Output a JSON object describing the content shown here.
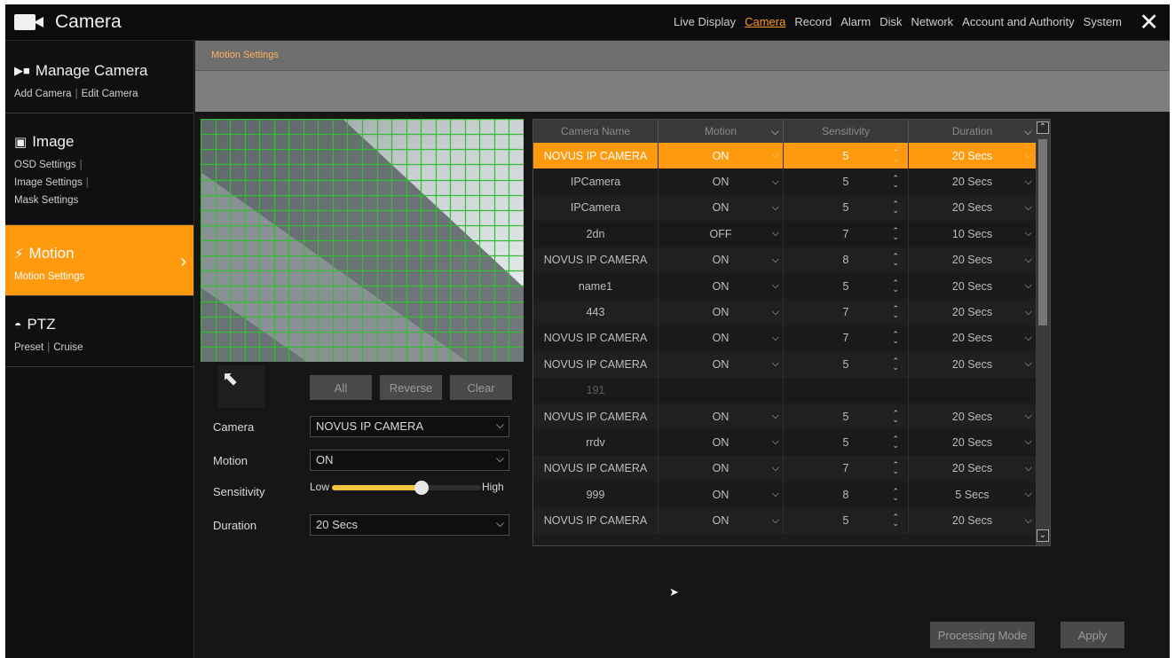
{
  "app": {
    "title": "Camera"
  },
  "topnav": [
    "Live Display",
    "Camera",
    "Record",
    "Alarm",
    "Disk",
    "Network",
    "Account and Authority",
    "System"
  ],
  "topnav_active": "Camera",
  "sidebar": {
    "manage": {
      "title": "Manage Camera",
      "links": [
        "Add Camera",
        "Edit Camera"
      ]
    },
    "image": {
      "title": "Image",
      "links": [
        "OSD Settings",
        "Image Settings",
        "Mask Settings"
      ]
    },
    "motion": {
      "title": "Motion",
      "links": [
        "Motion Settings"
      ]
    },
    "ptz": {
      "title": "PTZ",
      "links": [
        "Preset",
        "Cruise"
      ]
    }
  },
  "tab": {
    "label": "Motion Settings"
  },
  "grid_buttons": {
    "all": "All",
    "reverse": "Reverse",
    "clear": "Clear"
  },
  "form": {
    "camera_label": "Camera",
    "camera_value": "NOVUS IP CAMERA",
    "motion_label": "Motion",
    "motion_value": "ON",
    "sensitivity_label": "Sensitivity",
    "sensitivity_low": "Low",
    "sensitivity_high": "High",
    "sensitivity_level": 0.6,
    "duration_label": "Duration",
    "duration_value": "20 Secs"
  },
  "table": {
    "headers": [
      "Camera Name",
      "Motion",
      "Sensitivity",
      "Duration"
    ],
    "rows": [
      {
        "name": "NOVUS IP CAMERA",
        "motion": "ON",
        "sensitivity": "5",
        "duration": "20 Secs",
        "selected": true
      },
      {
        "name": "IPCamera",
        "motion": "ON",
        "sensitivity": "5",
        "duration": "20 Secs"
      },
      {
        "name": "IPCamera",
        "motion": "ON",
        "sensitivity": "5",
        "duration": "20 Secs"
      },
      {
        "name": "2dn",
        "motion": "OFF",
        "sensitivity": "7",
        "duration": "10 Secs"
      },
      {
        "name": "NOVUS IP CAMERA",
        "motion": "ON",
        "sensitivity": "8",
        "duration": "20 Secs"
      },
      {
        "name": "name1",
        "motion": "ON",
        "sensitivity": "5",
        "duration": "20 Secs"
      },
      {
        "name": "443",
        "motion": "ON",
        "sensitivity": "7",
        "duration": "20 Secs"
      },
      {
        "name": "NOVUS IP CAMERA",
        "motion": "ON",
        "sensitivity": "7",
        "duration": "20 Secs"
      },
      {
        "name": "NOVUS IP CAMERA",
        "motion": "ON",
        "sensitivity": "5",
        "duration": "20 Secs"
      },
      {
        "name": "191",
        "motion": "",
        "sensitivity": "",
        "duration": "",
        "dim": true
      },
      {
        "name": "NOVUS IP CAMERA",
        "motion": "ON",
        "sensitivity": "5",
        "duration": "20 Secs"
      },
      {
        "name": "rrdv",
        "motion": "ON",
        "sensitivity": "5",
        "duration": "20 Secs"
      },
      {
        "name": "NOVUS IP CAMERA",
        "motion": "ON",
        "sensitivity": "7",
        "duration": "20 Secs"
      },
      {
        "name": "999",
        "motion": "ON",
        "sensitivity": "8",
        "duration": "5 Secs"
      },
      {
        "name": "NOVUS IP CAMERA",
        "motion": "ON",
        "sensitivity": "5",
        "duration": "20 Secs"
      }
    ]
  },
  "footer": {
    "processing_mode": "Processing Mode",
    "apply": "Apply"
  },
  "colors": {
    "accent": "#ff9a0f",
    "grid": "#2fc02f",
    "slider": "#f2c43a"
  }
}
